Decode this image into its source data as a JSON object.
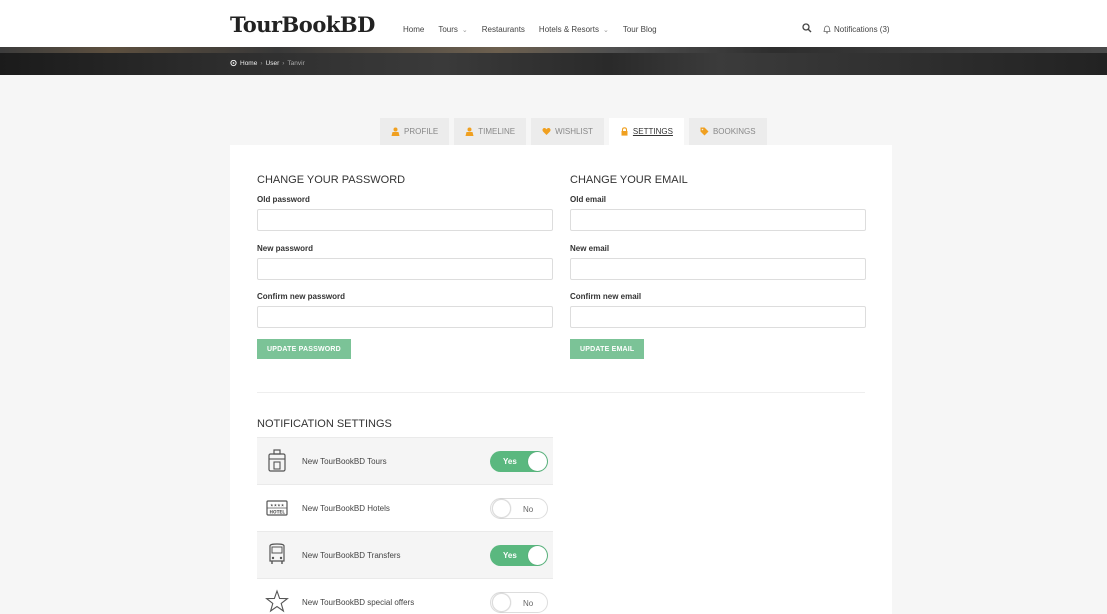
{
  "header": {
    "logo": "TourBookBD",
    "nav": [
      {
        "label": "Home",
        "dropdown": false
      },
      {
        "label": "Tours",
        "dropdown": true
      },
      {
        "label": "Restaurants",
        "dropdown": false
      },
      {
        "label": "Hotels & Resorts",
        "dropdown": true
      },
      {
        "label": "Tour Blog",
        "dropdown": false
      }
    ],
    "notifications": "Notifications (3)",
    "search_icon": "search-icon",
    "bell_icon": "bell-icon"
  },
  "breadcrumb": {
    "icon": "map-pin-icon",
    "items": [
      "Home",
      "User",
      "Tanvir"
    ]
  },
  "tabs": [
    {
      "label": "PROFILE",
      "icon": "user-icon",
      "active": false
    },
    {
      "label": "TIMELINE",
      "icon": "user-icon",
      "active": false
    },
    {
      "label": "WISHLIST",
      "icon": "heart-icon",
      "active": false
    },
    {
      "label": "SETTINGS",
      "icon": "lock-icon",
      "active": true
    },
    {
      "label": "BOOKINGS",
      "icon": "tag-icon",
      "active": false
    }
  ],
  "password": {
    "title": "CHANGE YOUR PASSWORD",
    "old_label": "Old password",
    "new_label": "New password",
    "confirm_label": "Confirm new password",
    "old_value": "",
    "new_value": "",
    "confirm_value": "",
    "button": "UPDATE PASSWORD"
  },
  "email": {
    "title": "CHANGE YOUR EMAIL",
    "old_label": "Old email",
    "new_label": "New email",
    "confirm_label": "Confirm new email",
    "old_value": "",
    "new_value": "",
    "confirm_value": "",
    "button": "UPDATE EMAIL"
  },
  "notification_settings": {
    "title": "NOTIFICATION SETTINGS",
    "items": [
      {
        "label": "New TourBookBD Tours",
        "icon": "luggage-icon",
        "enabled": true,
        "toggle_text": "Yes"
      },
      {
        "label": "New TourBookBD Hotels",
        "icon": "hotel-icon",
        "enabled": false,
        "toggle_text": "No"
      },
      {
        "label": "New TourBookBD Transfers",
        "icon": "bus-icon",
        "enabled": true,
        "toggle_text": "Yes"
      },
      {
        "label": "New TourBookBD special offers",
        "icon": "star-icon",
        "enabled": false,
        "toggle_text": "No"
      }
    ]
  },
  "colors": {
    "accent_orange": "#f0a020",
    "button_green": "#7bc397",
    "toggle_green": "#5ab87f"
  }
}
